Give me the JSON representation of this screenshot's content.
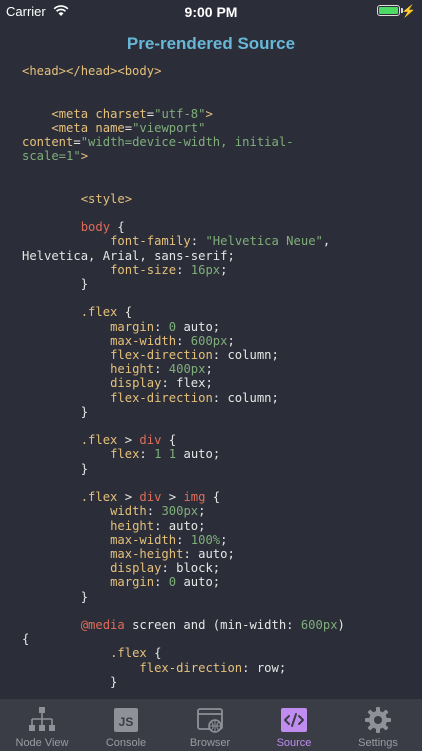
{
  "status_bar": {
    "carrier": "Carrier",
    "time": "9:00 PM"
  },
  "header": {
    "title": "Pre-rendered Source"
  },
  "code_lines": [
    [
      [
        "t-tag",
        "<head></head><body>"
      ]
    ],
    [],
    [],
    [
      [
        "t-txt",
        "    "
      ],
      [
        "t-tag",
        "<meta "
      ],
      [
        "t-attr",
        "charset"
      ],
      [
        "t-txt",
        "="
      ],
      [
        "t-str",
        "\"utf-8\""
      ],
      [
        "t-tag",
        ">"
      ]
    ],
    [
      [
        "t-txt",
        "    "
      ],
      [
        "t-tag",
        "<meta "
      ],
      [
        "t-attr",
        "name"
      ],
      [
        "t-txt",
        "="
      ],
      [
        "t-str",
        "\"viewport\""
      ]
    ],
    [
      [
        "t-attr",
        "content"
      ],
      [
        "t-txt",
        "="
      ],
      [
        "t-str",
        "\"width=device-width, initial-"
      ]
    ],
    [
      [
        "t-str",
        "scale=1\""
      ],
      [
        "t-tag",
        ">"
      ]
    ],
    [],
    [],
    [
      [
        "t-txt",
        "        "
      ],
      [
        "t-tag",
        "<style>"
      ]
    ],
    [],
    [
      [
        "t-txt",
        "        "
      ],
      [
        "t-el",
        "body"
      ],
      [
        "t-txt",
        " {"
      ]
    ],
    [
      [
        "t-txt",
        "            "
      ],
      [
        "t-prop",
        "font-family"
      ],
      [
        "t-txt",
        ": "
      ],
      [
        "t-str",
        "\"Helvetica Neue\""
      ],
      [
        "t-txt",
        ","
      ]
    ],
    [
      [
        "t-txt",
        "Helvetica, Arial, sans-serif;"
      ]
    ],
    [
      [
        "t-txt",
        "            "
      ],
      [
        "t-prop",
        "font-size"
      ],
      [
        "t-txt",
        ": "
      ],
      [
        "t-num",
        "16px"
      ],
      [
        "t-txt",
        ";"
      ]
    ],
    [
      [
        "t-txt",
        "        }"
      ]
    ],
    [],
    [
      [
        "t-txt",
        "        "
      ],
      [
        "t-sel",
        ".flex"
      ],
      [
        "t-txt",
        " {"
      ]
    ],
    [
      [
        "t-txt",
        "            "
      ],
      [
        "t-prop",
        "margin"
      ],
      [
        "t-txt",
        ": "
      ],
      [
        "t-num",
        "0"
      ],
      [
        "t-txt",
        " auto;"
      ]
    ],
    [
      [
        "t-txt",
        "            "
      ],
      [
        "t-prop",
        "max-width"
      ],
      [
        "t-txt",
        ": "
      ],
      [
        "t-num",
        "600px"
      ],
      [
        "t-txt",
        ";"
      ]
    ],
    [
      [
        "t-txt",
        "            "
      ],
      [
        "t-prop",
        "flex-direction"
      ],
      [
        "t-txt",
        ": column;"
      ]
    ],
    [
      [
        "t-txt",
        "            "
      ],
      [
        "t-prop",
        "height"
      ],
      [
        "t-txt",
        ": "
      ],
      [
        "t-num",
        "400px"
      ],
      [
        "t-txt",
        ";"
      ]
    ],
    [
      [
        "t-txt",
        "            "
      ],
      [
        "t-prop",
        "display"
      ],
      [
        "t-txt",
        ": flex;"
      ]
    ],
    [
      [
        "t-txt",
        "            "
      ],
      [
        "t-prop",
        "flex-direction"
      ],
      [
        "t-txt",
        ": column;"
      ]
    ],
    [
      [
        "t-txt",
        "        }"
      ]
    ],
    [],
    [
      [
        "t-txt",
        "        "
      ],
      [
        "t-sel",
        ".flex"
      ],
      [
        "t-txt",
        " > "
      ],
      [
        "t-el",
        "div"
      ],
      [
        "t-txt",
        " {"
      ]
    ],
    [
      [
        "t-txt",
        "            "
      ],
      [
        "t-prop",
        "flex"
      ],
      [
        "t-txt",
        ": "
      ],
      [
        "t-num",
        "1"
      ],
      [
        "t-txt",
        " "
      ],
      [
        "t-num",
        "1"
      ],
      [
        "t-txt",
        " auto;"
      ]
    ],
    [
      [
        "t-txt",
        "        }"
      ]
    ],
    [],
    [
      [
        "t-txt",
        "        "
      ],
      [
        "t-sel",
        ".flex"
      ],
      [
        "t-txt",
        " > "
      ],
      [
        "t-el",
        "div"
      ],
      [
        "t-txt",
        " > "
      ],
      [
        "t-el",
        "img"
      ],
      [
        "t-txt",
        " {"
      ]
    ],
    [
      [
        "t-txt",
        "            "
      ],
      [
        "t-prop",
        "width"
      ],
      [
        "t-txt",
        ": "
      ],
      [
        "t-num",
        "300px"
      ],
      [
        "t-txt",
        ";"
      ]
    ],
    [
      [
        "t-txt",
        "            "
      ],
      [
        "t-prop",
        "height"
      ],
      [
        "t-txt",
        ": auto;"
      ]
    ],
    [
      [
        "t-txt",
        "            "
      ],
      [
        "t-prop",
        "max-width"
      ],
      [
        "t-txt",
        ": "
      ],
      [
        "t-num",
        "100%"
      ],
      [
        "t-txt",
        ";"
      ]
    ],
    [
      [
        "t-txt",
        "            "
      ],
      [
        "t-prop",
        "max-height"
      ],
      [
        "t-txt",
        ": auto;"
      ]
    ],
    [
      [
        "t-txt",
        "            "
      ],
      [
        "t-prop",
        "display"
      ],
      [
        "t-txt",
        ": block;"
      ]
    ],
    [
      [
        "t-txt",
        "            "
      ],
      [
        "t-prop",
        "margin"
      ],
      [
        "t-txt",
        ": "
      ],
      [
        "t-num",
        "0"
      ],
      [
        "t-txt",
        " auto;"
      ]
    ],
    [
      [
        "t-txt",
        "        }"
      ]
    ],
    [],
    [
      [
        "t-txt",
        "        "
      ],
      [
        "t-at",
        "@media"
      ],
      [
        "t-txt",
        " screen and (min-width: "
      ],
      [
        "t-num",
        "600px"
      ],
      [
        "t-txt",
        ")"
      ]
    ],
    [
      [
        "t-txt",
        "{"
      ]
    ],
    [
      [
        "t-txt",
        "            "
      ],
      [
        "t-sel",
        ".flex"
      ],
      [
        "t-txt",
        " {"
      ]
    ],
    [
      [
        "t-txt",
        "                "
      ],
      [
        "t-prop",
        "flex-direction"
      ],
      [
        "t-txt",
        ": row;"
      ]
    ],
    [
      [
        "t-txt",
        "            }"
      ]
    ]
  ],
  "tabs": [
    {
      "label": "Node View",
      "icon": "node-view-icon",
      "active": false
    },
    {
      "label": "Console",
      "icon": "console-icon",
      "active": false
    },
    {
      "label": "Browser",
      "icon": "browser-icon",
      "active": false
    },
    {
      "label": "Source",
      "icon": "source-icon",
      "active": true
    },
    {
      "label": "Settings",
      "icon": "settings-icon",
      "active": false
    }
  ],
  "colors": {
    "accent": "#c08cf0",
    "title": "#68b7d8",
    "background": "#2b2e38"
  }
}
